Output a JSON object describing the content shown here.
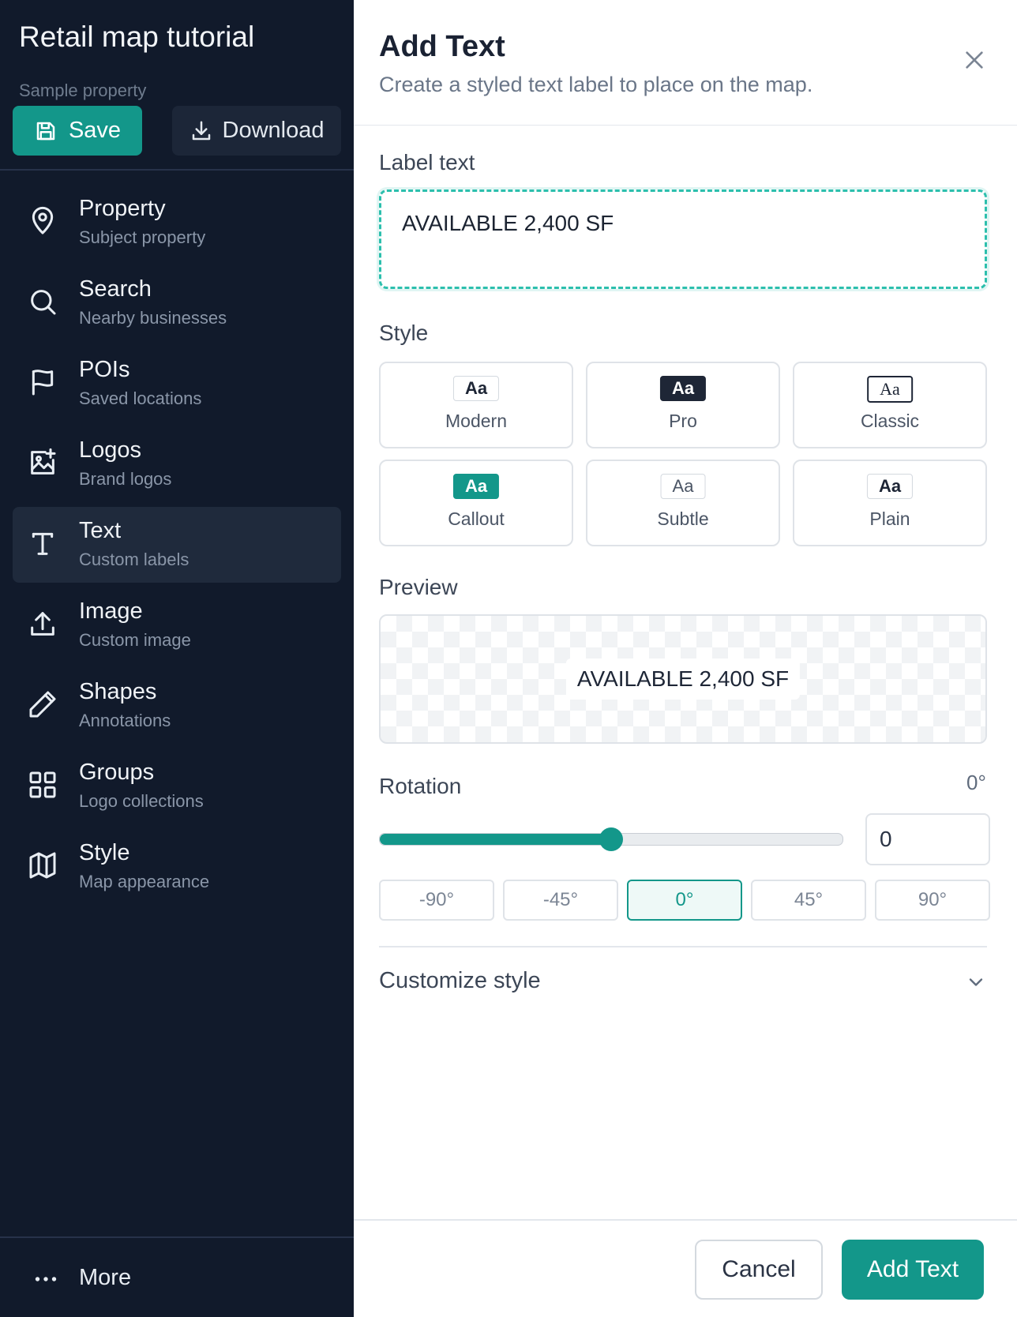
{
  "sidebar": {
    "title": "Retail map tutorial",
    "subtitle": "Sample property",
    "save_label": "Save",
    "download_label": "Download",
    "items": [
      {
        "label": "Property",
        "sub": "Subject property",
        "icon": "map-pin-icon"
      },
      {
        "label": "Search",
        "sub": "Nearby businesses",
        "icon": "search-icon"
      },
      {
        "label": "POIs",
        "sub": "Saved locations",
        "icon": "flag-icon"
      },
      {
        "label": "Logos",
        "sub": "Brand logos",
        "icon": "image-plus-icon"
      },
      {
        "label": "Text",
        "sub": "Custom labels",
        "icon": "text-icon",
        "active": true
      },
      {
        "label": "Image",
        "sub": "Custom image",
        "icon": "upload-icon"
      },
      {
        "label": "Shapes",
        "sub": "Annotations",
        "icon": "pencil-icon"
      },
      {
        "label": "Groups",
        "sub": "Logo collections",
        "icon": "grid-icon"
      },
      {
        "label": "Style",
        "sub": "Map appearance",
        "icon": "map-icon"
      }
    ],
    "more_label": "More"
  },
  "panel": {
    "title": "Add Text",
    "subtitle": "Create a styled text label to place on the map.",
    "label_text_heading": "Label text",
    "label_text_value": "AVAILABLE 2,400 SF",
    "style_heading": "Style",
    "styles": [
      {
        "chip": "Aa",
        "name": "Modern"
      },
      {
        "chip": "Aa",
        "name": "Pro"
      },
      {
        "chip": "Aa",
        "name": "Classic"
      },
      {
        "chip": "Aa",
        "name": "Callout"
      },
      {
        "chip": "Aa",
        "name": "Subtle"
      },
      {
        "chip": "Aa",
        "name": "Plain"
      }
    ],
    "preview_heading": "Preview",
    "preview_text": "AVAILABLE 2,400 SF",
    "rotation_heading": "Rotation",
    "rotation_display": "0°",
    "rotation_input": "0",
    "rotation_slider_fraction": 0.5,
    "rotation_presets": [
      "-90°",
      "-45°",
      "0°",
      "45°",
      "90°"
    ],
    "rotation_active_preset": "0°",
    "customize_label": "Customize style",
    "cancel_label": "Cancel",
    "add_label": "Add Text"
  },
  "colors": {
    "sidebar_bg": "#111a2b",
    "accent": "#13978a",
    "active_item_bg": "#1f2a3c"
  }
}
